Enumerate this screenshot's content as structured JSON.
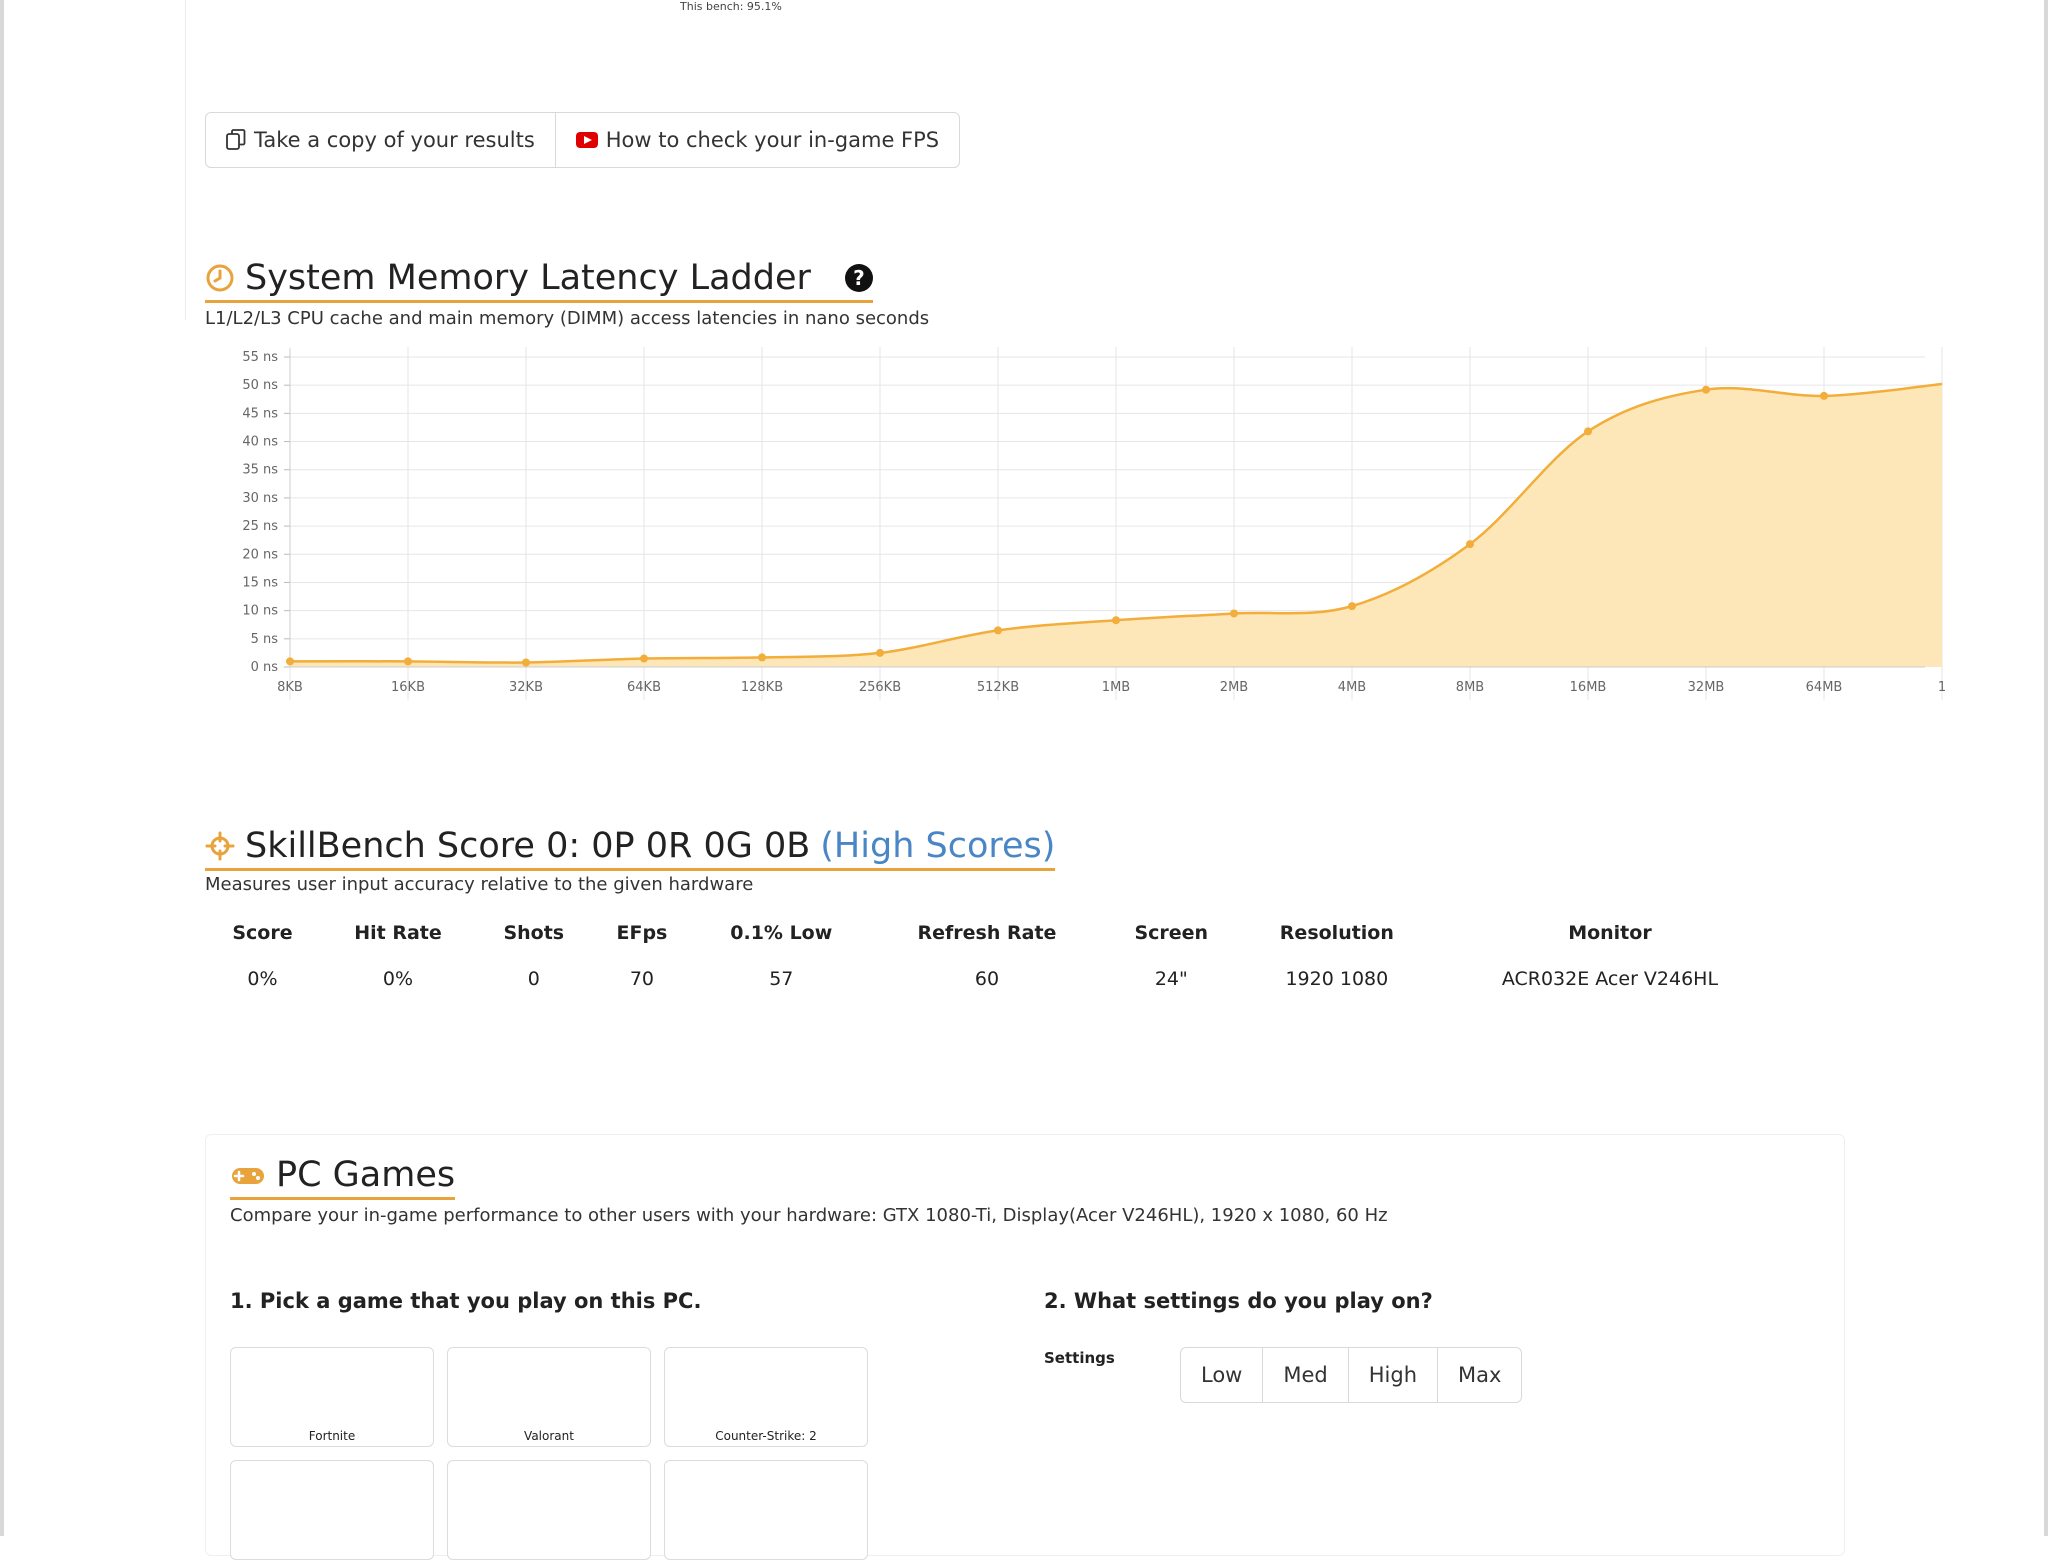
{
  "bench_note": "This bench: 95.1%",
  "actions": {
    "copy_results": "Take a copy of your results",
    "check_fps": "How to check your in-game FPS"
  },
  "latency": {
    "title": "System Memory Latency Ladder",
    "help_glyph": "?",
    "subtitle": "L1/L2/L3 CPU cache and main memory (DIMM) access latencies in nano seconds",
    "accent_color": "#f2ad3a",
    "fill_color": "#fde6b8",
    "chart_data": {
      "type": "area",
      "title": "",
      "xlabel": "",
      "ylabel": "",
      "categories": [
        "8KB",
        "16KB",
        "32KB",
        "64KB",
        "128KB",
        "256KB",
        "512KB",
        "1MB",
        "2MB",
        "4MB",
        "8MB",
        "16MB",
        "32MB",
        "64MB",
        "1"
      ],
      "series": [
        {
          "values": [
            1,
            1,
            0.8,
            1.5,
            1.7,
            2.5,
            6.5,
            8.3,
            9.5,
            10.8,
            21.8,
            41.8,
            49.2,
            48.1,
            50.2
          ]
        }
      ],
      "yticks": [
        "0 ns",
        "5 ns",
        "10 ns",
        "15 ns",
        "20 ns",
        "25 ns",
        "30 ns",
        "35 ns",
        "40 ns",
        "45 ns",
        "50 ns",
        "55 ns"
      ],
      "ylim": [
        0,
        55
      ],
      "grid": true,
      "legend": "none"
    }
  },
  "skillbench": {
    "title": "SkillBench Score 0: 0P 0R 0G 0B",
    "link": "(High Scores)",
    "subtitle": "Measures user input accuracy relative to the given hardware",
    "headers": [
      "Score",
      "Hit Rate",
      "Shots",
      "EFps",
      "0.1% Low",
      "Refresh Rate",
      "Screen",
      "Resolution",
      "Monitor"
    ],
    "row": [
      "0%",
      "0%",
      "0",
      "70",
      "57",
      "60",
      "24\"",
      "1920 1080",
      "ACR032E Acer V246HL"
    ]
  },
  "games": {
    "title": "PC Games",
    "subtitle": "Compare your in-game performance to other users with your hardware: GTX 1080-Ti, Display(Acer V246HL), 1920 x 1080, 60 Hz",
    "step1": "1. Pick a game that you play on this PC.",
    "step2": "2. What settings do you play on?",
    "settings_label": "Settings",
    "tiles": [
      "Fortnite",
      "Valorant",
      "Counter-Strike: 2",
      "",
      "",
      ""
    ],
    "settings": [
      "Low",
      "Med",
      "High",
      "Max"
    ]
  }
}
